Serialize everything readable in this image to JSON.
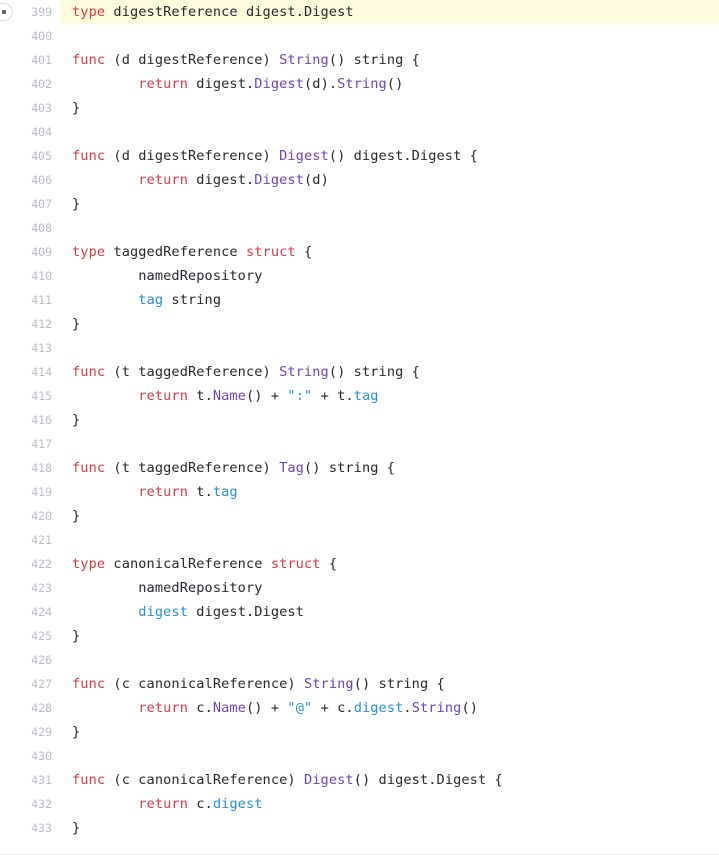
{
  "viewer": {
    "name": "code-viewer",
    "language": "go",
    "first_line": 399,
    "last_line": 433,
    "highlighted_line": 399,
    "colors": {
      "background": "#ffffff",
      "highlight": "#fffbdd",
      "line_number": "#b9bdc4",
      "text": "#24292e",
      "keyword": "#d73a49",
      "method": "#6f42c1",
      "field": "#258fd6",
      "string": "#258fd6"
    },
    "marker": {
      "icon": "breakpoint-marker-icon",
      "line": 399
    }
  },
  "lines": [
    {
      "number": "399",
      "highlight": true,
      "marker": true,
      "tokens": [
        {
          "t": "type",
          "c": "keyword"
        },
        {
          "t": " digestReference digest.Digest",
          "c": "plain"
        }
      ]
    },
    {
      "number": "400",
      "tokens": []
    },
    {
      "number": "401",
      "tokens": [
        {
          "t": "func",
          "c": "keyword"
        },
        {
          "t": " (d digestReference) ",
          "c": "plain"
        },
        {
          "t": "String",
          "c": "method"
        },
        {
          "t": "() string {",
          "c": "plain"
        }
      ]
    },
    {
      "number": "402",
      "tokens": [
        {
          "t": "        ",
          "c": "plain"
        },
        {
          "t": "return",
          "c": "keyword"
        },
        {
          "t": " digest.",
          "c": "plain"
        },
        {
          "t": "Digest",
          "c": "method"
        },
        {
          "t": "(d).",
          "c": "plain"
        },
        {
          "t": "String",
          "c": "method"
        },
        {
          "t": "()",
          "c": "plain"
        }
      ]
    },
    {
      "number": "403",
      "tokens": [
        {
          "t": "}",
          "c": "plain"
        }
      ]
    },
    {
      "number": "404",
      "tokens": []
    },
    {
      "number": "405",
      "tokens": [
        {
          "t": "func",
          "c": "keyword"
        },
        {
          "t": " (d digestReference) ",
          "c": "plain"
        },
        {
          "t": "Digest",
          "c": "method"
        },
        {
          "t": "() digest.Digest {",
          "c": "plain"
        }
      ]
    },
    {
      "number": "406",
      "tokens": [
        {
          "t": "        ",
          "c": "plain"
        },
        {
          "t": "return",
          "c": "keyword"
        },
        {
          "t": " digest.",
          "c": "plain"
        },
        {
          "t": "Digest",
          "c": "method"
        },
        {
          "t": "(d)",
          "c": "plain"
        }
      ]
    },
    {
      "number": "407",
      "tokens": [
        {
          "t": "}",
          "c": "plain"
        }
      ]
    },
    {
      "number": "408",
      "tokens": []
    },
    {
      "number": "409",
      "tokens": [
        {
          "t": "type",
          "c": "keyword"
        },
        {
          "t": " taggedReference ",
          "c": "plain"
        },
        {
          "t": "struct",
          "c": "keyword"
        },
        {
          "t": " {",
          "c": "plain"
        }
      ]
    },
    {
      "number": "410",
      "tokens": [
        {
          "t": "        namedRepository",
          "c": "plain"
        }
      ]
    },
    {
      "number": "411",
      "tokens": [
        {
          "t": "        ",
          "c": "plain"
        },
        {
          "t": "tag",
          "c": "field"
        },
        {
          "t": " string",
          "c": "plain"
        }
      ]
    },
    {
      "number": "412",
      "tokens": [
        {
          "t": "}",
          "c": "plain"
        }
      ]
    },
    {
      "number": "413",
      "tokens": []
    },
    {
      "number": "414",
      "tokens": [
        {
          "t": "func",
          "c": "keyword"
        },
        {
          "t": " (t taggedReference) ",
          "c": "plain"
        },
        {
          "t": "String",
          "c": "method"
        },
        {
          "t": "() string {",
          "c": "plain"
        }
      ]
    },
    {
      "number": "415",
      "tokens": [
        {
          "t": "        ",
          "c": "plain"
        },
        {
          "t": "return",
          "c": "keyword"
        },
        {
          "t": " t.",
          "c": "plain"
        },
        {
          "t": "Name",
          "c": "method"
        },
        {
          "t": "() + ",
          "c": "plain"
        },
        {
          "t": "\":\"",
          "c": "string"
        },
        {
          "t": " + t.",
          "c": "plain"
        },
        {
          "t": "tag",
          "c": "field"
        }
      ]
    },
    {
      "number": "416",
      "tokens": [
        {
          "t": "}",
          "c": "plain"
        }
      ]
    },
    {
      "number": "417",
      "tokens": []
    },
    {
      "number": "418",
      "tokens": [
        {
          "t": "func",
          "c": "keyword"
        },
        {
          "t": " (t taggedReference) ",
          "c": "plain"
        },
        {
          "t": "Tag",
          "c": "method"
        },
        {
          "t": "() string {",
          "c": "plain"
        }
      ]
    },
    {
      "number": "419",
      "tokens": [
        {
          "t": "        ",
          "c": "plain"
        },
        {
          "t": "return",
          "c": "keyword"
        },
        {
          "t": " t.",
          "c": "plain"
        },
        {
          "t": "tag",
          "c": "field"
        }
      ]
    },
    {
      "number": "420",
      "tokens": [
        {
          "t": "}",
          "c": "plain"
        }
      ]
    },
    {
      "number": "421",
      "tokens": []
    },
    {
      "number": "422",
      "tokens": [
        {
          "t": "type",
          "c": "keyword"
        },
        {
          "t": " canonicalReference ",
          "c": "plain"
        },
        {
          "t": "struct",
          "c": "keyword"
        },
        {
          "t": " {",
          "c": "plain"
        }
      ]
    },
    {
      "number": "423",
      "tokens": [
        {
          "t": "        namedRepository",
          "c": "plain"
        }
      ]
    },
    {
      "number": "424",
      "tokens": [
        {
          "t": "        ",
          "c": "plain"
        },
        {
          "t": "digest",
          "c": "field"
        },
        {
          "t": " digest.Digest",
          "c": "plain"
        }
      ]
    },
    {
      "number": "425",
      "tokens": [
        {
          "t": "}",
          "c": "plain"
        }
      ]
    },
    {
      "number": "426",
      "tokens": []
    },
    {
      "number": "427",
      "tokens": [
        {
          "t": "func",
          "c": "keyword"
        },
        {
          "t": " (c canonicalReference) ",
          "c": "plain"
        },
        {
          "t": "String",
          "c": "method"
        },
        {
          "t": "() string {",
          "c": "plain"
        }
      ]
    },
    {
      "number": "428",
      "tokens": [
        {
          "t": "        ",
          "c": "plain"
        },
        {
          "t": "return",
          "c": "keyword"
        },
        {
          "t": " c.",
          "c": "plain"
        },
        {
          "t": "Name",
          "c": "method"
        },
        {
          "t": "() + ",
          "c": "plain"
        },
        {
          "t": "\"@\"",
          "c": "string"
        },
        {
          "t": " + c.",
          "c": "plain"
        },
        {
          "t": "digest",
          "c": "field"
        },
        {
          "t": ".",
          "c": "plain"
        },
        {
          "t": "String",
          "c": "method"
        },
        {
          "t": "()",
          "c": "plain"
        }
      ]
    },
    {
      "number": "429",
      "tokens": [
        {
          "t": "}",
          "c": "plain"
        }
      ]
    },
    {
      "number": "430",
      "tokens": []
    },
    {
      "number": "431",
      "tokens": [
        {
          "t": "func",
          "c": "keyword"
        },
        {
          "t": " (c canonicalReference) ",
          "c": "plain"
        },
        {
          "t": "Digest",
          "c": "method"
        },
        {
          "t": "() digest.Digest {",
          "c": "plain"
        }
      ]
    },
    {
      "number": "432",
      "tokens": [
        {
          "t": "        ",
          "c": "plain"
        },
        {
          "t": "return",
          "c": "keyword"
        },
        {
          "t": " c.",
          "c": "plain"
        },
        {
          "t": "digest",
          "c": "field"
        }
      ]
    },
    {
      "number": "433",
      "tokens": [
        {
          "t": "}",
          "c": "plain"
        }
      ]
    }
  ]
}
